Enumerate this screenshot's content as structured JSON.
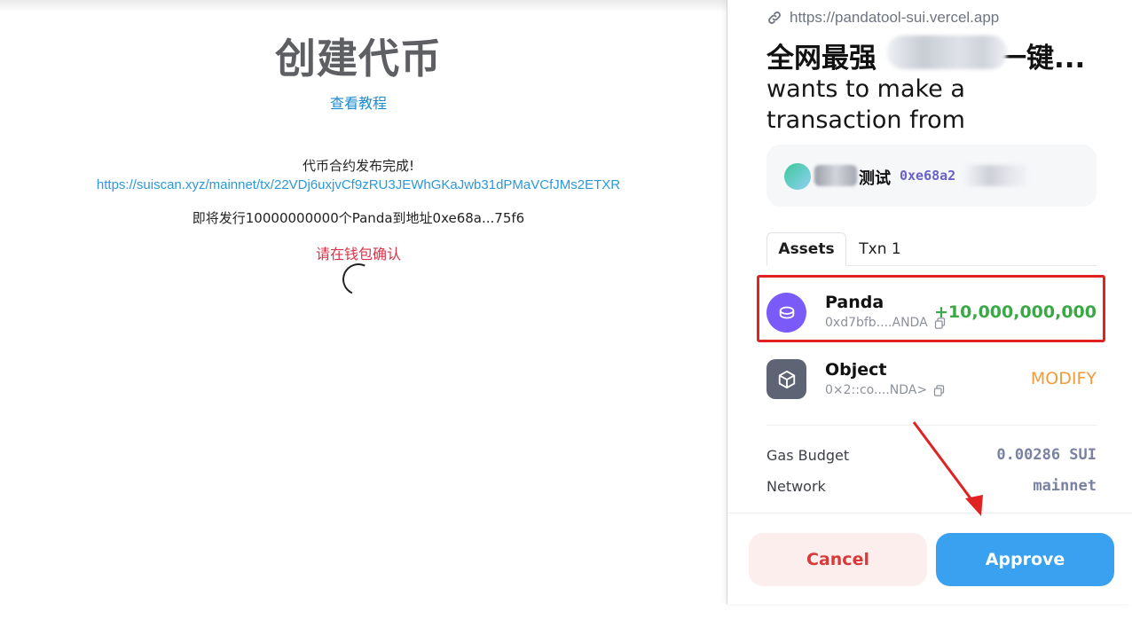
{
  "left_page": {
    "title": "创建代币",
    "tutorial_link": "查看教程",
    "publish_done": "代币合约发布完成!",
    "tx_link": "https://suiscan.xyz/mainnet/tx/22VDj6uxjvCf9zRU3JEWhGKaJwb31dPMaVCfJMs2ETXR",
    "issue_text": "即将发行10000000000个Panda到地址0xe68a...75f6",
    "wallet_prompt": "请在钱包确认"
  },
  "wallet": {
    "origin_url": "https://pandatool-sui.vercel.app",
    "app_name_prefix": "全网最强",
    "app_name_suffix": "一键...",
    "request_text": "wants to make a transaction from",
    "account": {
      "name": "测试",
      "address": "0xe68a2"
    },
    "tabs": [
      "Assets",
      "Txn 1"
    ],
    "assets": [
      {
        "name": "Panda",
        "id": "0xd7bfb....ANDA",
        "change": "+10,000,000,000",
        "icon": "coin-icon"
      },
      {
        "name": "Object",
        "id": "0×2::co....NDA>",
        "change": "MODIFY",
        "icon": "cube-icon"
      }
    ],
    "gas_label": "Gas Budget",
    "gas_value": "0.00286 SUI",
    "network_label": "Network",
    "network_value": "mainnet",
    "cancel_label": "Cancel",
    "approve_label": "Approve"
  },
  "colors": {
    "approve": "#3aa0f0",
    "cancel_text": "#d83a3a",
    "positive": "#39a845",
    "modify": "#f39a3a",
    "highlight": "#e02222"
  }
}
